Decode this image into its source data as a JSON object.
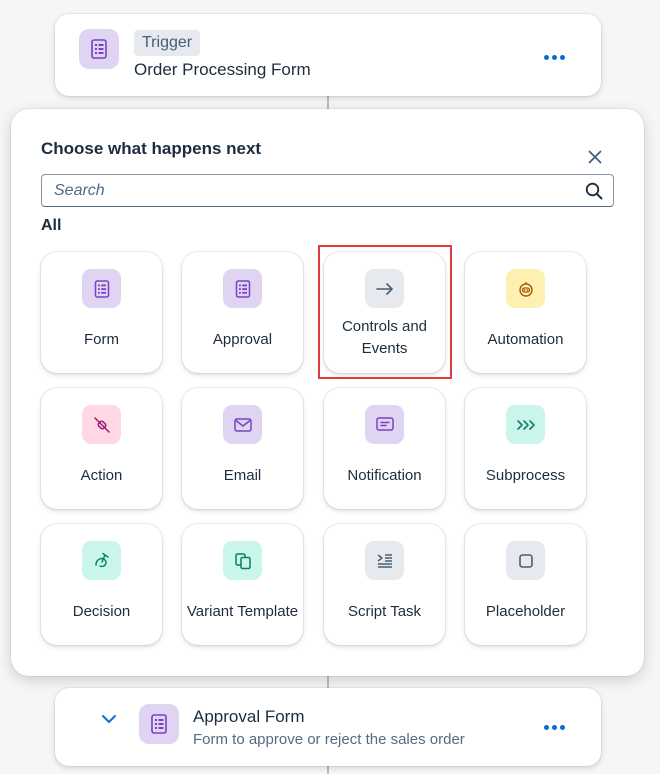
{
  "trigger_card": {
    "badge": "Trigger",
    "title": "Order Processing Form",
    "icon": "form-icon",
    "more_icon": "more-icon"
  },
  "picker": {
    "title": "Choose what happens next",
    "close_icon": "close-icon",
    "search": {
      "placeholder": "Search",
      "value": "",
      "icon": "search-icon"
    },
    "section_label": "All",
    "highlighted_tile": "Controls and Events",
    "tiles": [
      {
        "label": "Form",
        "icon": "form-icon",
        "icon_bg": "#e0d4f3",
        "icon_color": "#7a41c4"
      },
      {
        "label": "Approval",
        "icon": "approval-icon",
        "icon_bg": "#e0d4f3",
        "icon_color": "#7a41c4"
      },
      {
        "label": "Controls and Events",
        "icon": "arrow-right-icon",
        "icon_bg": "#e6e9ed",
        "icon_color": "#475e75"
      },
      {
        "label": "Automation",
        "icon": "robot-icon",
        "icon_bg": "#fdf0b0",
        "icon_color": "#a05c0d"
      },
      {
        "label": "Action",
        "icon": "plug-icon",
        "icon_bg": "#ffd8e4",
        "icon_color": "#a1176e"
      },
      {
        "label": "Email",
        "icon": "email-icon",
        "icon_bg": "#e0d4f3",
        "icon_color": "#7a41c4"
      },
      {
        "label": "Notification",
        "icon": "message-icon",
        "icon_bg": "#e0d4f3",
        "icon_color": "#7a41c4"
      },
      {
        "label": "Subprocess",
        "icon": "chevrons-right-icon",
        "icon_bg": "#c9f5ea",
        "icon_color": "#0b7e6b"
      },
      {
        "label": "Decision",
        "icon": "decision-icon",
        "icon_bg": "#c9f5ea",
        "icon_color": "#0b7e6b"
      },
      {
        "label": "Variant Template",
        "icon": "copy-icon",
        "icon_bg": "#c9f5ea",
        "icon_color": "#0b7e6b"
      },
      {
        "label": "Script Task",
        "icon": "script-icon",
        "icon_bg": "#e6e9ed",
        "icon_color": "#475e75"
      },
      {
        "label": "Placeholder",
        "icon": "placeholder-icon",
        "icon_bg": "#e6e9ed",
        "icon_color": "#475e75"
      }
    ]
  },
  "approval_card": {
    "title": "Approval Form",
    "description": "Form to approve or reject the sales order",
    "icon": "form-icon",
    "expand_icon": "chevron-down-icon",
    "more_icon": "more-icon"
  },
  "colors": {
    "accent": "#0a6ed1",
    "highlight_border": "#e0393e",
    "text": "#1d2d3e",
    "secondary_text": "#556b81"
  }
}
